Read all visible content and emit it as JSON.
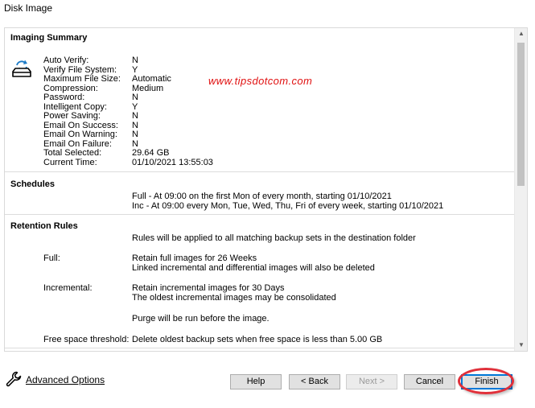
{
  "window": {
    "title": "Disk Image"
  },
  "watermark": "www.tipsdotcom.com",
  "summary": {
    "title": "Imaging Summary",
    "icon": "drive-sync-icon",
    "rows": [
      {
        "label": "Auto Verify:",
        "value": "N"
      },
      {
        "label": "Verify File System:",
        "value": "Y"
      },
      {
        "label": "Maximum File Size:",
        "value": "Automatic"
      },
      {
        "label": "Compression:",
        "value": "Medium"
      },
      {
        "label": "Password:",
        "value": "N"
      },
      {
        "label": "Intelligent Copy:",
        "value": "Y"
      },
      {
        "label": "Power Saving:",
        "value": "N"
      },
      {
        "label": "Email On Success:",
        "value": "N"
      },
      {
        "label": "Email On Warning:",
        "value": "N"
      },
      {
        "label": "Email On Failure:",
        "value": "N"
      },
      {
        "label": "Total Selected:",
        "value": "29.64 GB"
      },
      {
        "label": "Current Time:",
        "value": "01/10/2021 13:55:03"
      }
    ]
  },
  "schedules": {
    "title": "Schedules",
    "lines": [
      "Full - At 09:00 on the first Mon of every month, starting 01/10/2021",
      "Inc - At 09:00 every Mon, Tue, Wed, Thu, Fri of every week, starting 01/10/2021"
    ]
  },
  "retention": {
    "title": "Retention Rules",
    "intro": "Rules will be applied to all matching backup sets in the destination folder",
    "full_label": "Full:",
    "full_lines": [
      "Retain full images for 26 Weeks",
      "Linked incremental and differential images will also be deleted"
    ],
    "incremental_label": "Incremental:",
    "incremental_lines": [
      "Retain incremental images for 30 Days",
      "The oldest incremental images may be consolidated"
    ],
    "purge": "Purge will be run before the image.",
    "threshold_label": "Free space threshold:",
    "threshold_value": "Delete oldest backup sets when free space is less than 5.00 GB"
  },
  "footer": {
    "advanced_options": "Advanced Options",
    "help": "Help",
    "back": "< Back",
    "next": "Next >",
    "cancel": "Cancel",
    "finish": "Finish"
  },
  "colors": {
    "highlight": "#e0303a",
    "watermark": "#e01010",
    "default_button_border": "#0078d7"
  }
}
